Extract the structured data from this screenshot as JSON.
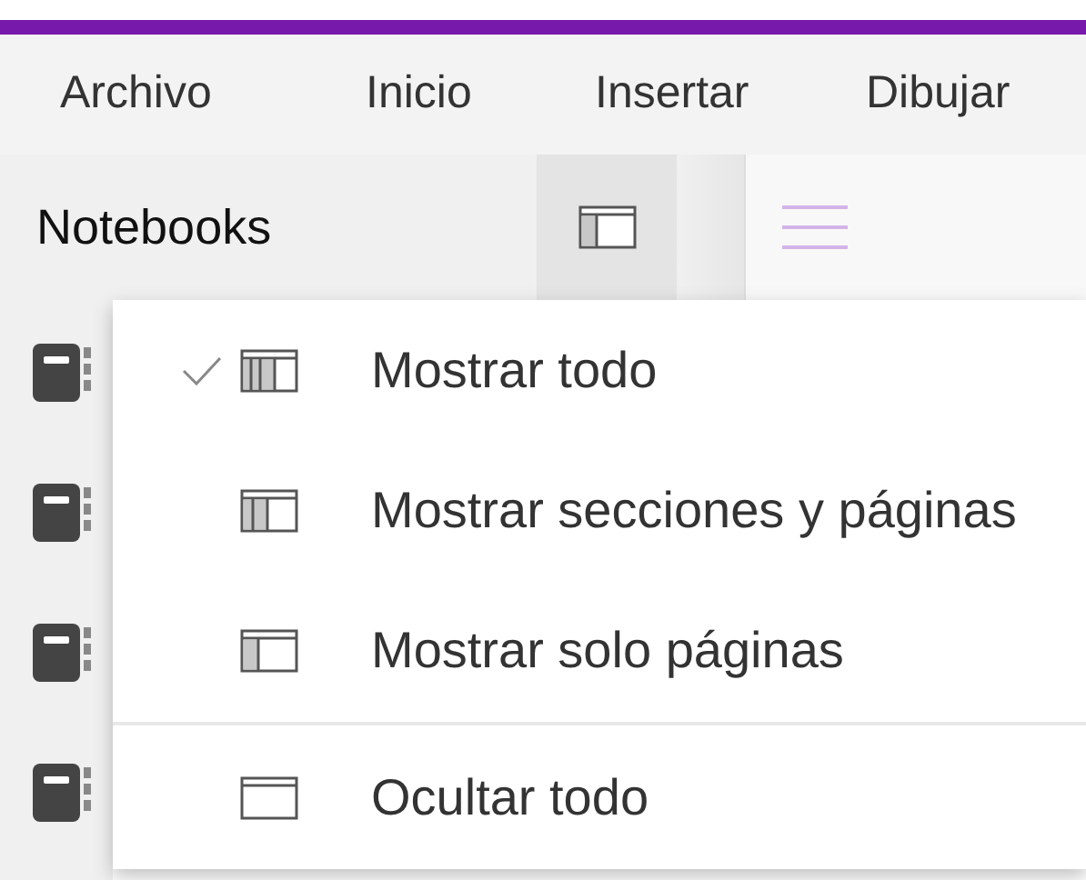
{
  "menu_bar": [
    "Archivo",
    "Inicio",
    "Insertar",
    "Dibujar"
  ],
  "sidebar": {
    "title": "Notebooks"
  },
  "view_menu": {
    "items": [
      {
        "kind": "all",
        "label": "Mostrar todo",
        "selected": true
      },
      {
        "kind": "sections",
        "label": "Mostrar secciones y páginas",
        "selected": false
      },
      {
        "kind": "pages",
        "label": "Mostrar solo páginas",
        "selected": false
      },
      {
        "kind": "hide",
        "label": "Ocultar todo",
        "selected": false
      }
    ]
  }
}
